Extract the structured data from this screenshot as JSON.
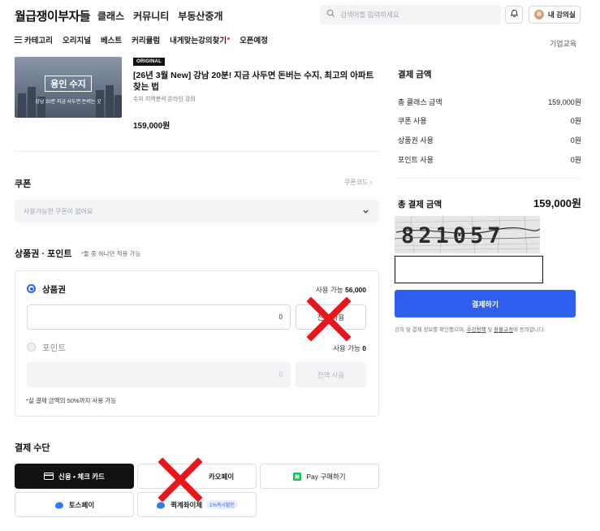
{
  "header": {
    "logo": "월급쟁이부자들",
    "nav": [
      "클래스",
      "커뮤니티",
      "부동산중개"
    ],
    "search_placeholder": "검색어를 입력하세요",
    "user_label": "내 강의실"
  },
  "subnav": {
    "items": [
      "카테고리",
      "오리지널",
      "베스트",
      "커리큘럼",
      "내게맞는강의찾기",
      "오픈예정"
    ],
    "business_link": "기업교육"
  },
  "product": {
    "thumbnail_title": "용인 수지",
    "thumbnail_subtitle": "강남 20분 지금 사두면 돈버는 곳",
    "badge": "ORIGINAL",
    "title": "[26년 3월 New] 강남 20분! 지금 사두면 돈버는 수지, 최고의 아파트 찾는 법",
    "subtitle": "수지 지역분석 온라인 강의",
    "price": "159,000원"
  },
  "coupon": {
    "heading": "쿠폰",
    "code_link": "쿠폰코드 ›",
    "select_placeholder": "사용가능한 쿠폰이 없어요"
  },
  "gift_point": {
    "heading": "상품권 · 포인트",
    "note": "*둘 중 하나만 적용 가능",
    "gift": {
      "label": "상품권",
      "available_prefix": "사용 가능",
      "available_value": "56,000",
      "input_value": "0",
      "all_button": "전액 사용"
    },
    "point": {
      "label": "포인트",
      "available_prefix": "사용 가능",
      "available_value": "0",
      "input_value": "0",
      "all_button": "전액 사용"
    },
    "limit_note": "*실 결제 금액의 50%까지 사용 가능"
  },
  "payment_method": {
    "heading": "결제 수단",
    "options": [
      {
        "label": "신용 • 체크 카드",
        "selected": true
      },
      {
        "label": "카오페이",
        "selected": false
      },
      {
        "label": "Pay 구매하기",
        "selected": false
      },
      {
        "label": "토스페이",
        "selected": false
      },
      {
        "label": "퀵계좌이체",
        "selected": false,
        "tag": "1%즉시할인"
      }
    ]
  },
  "summary": {
    "title": "결제 금액",
    "rows": [
      {
        "label": "총 클래스 금액",
        "value": "159,000원"
      },
      {
        "label": "쿠폰 사용",
        "value": "0원"
      },
      {
        "label": "상품권 사용",
        "value": "0원"
      },
      {
        "label": "포인트 사용",
        "value": "0원"
      }
    ],
    "total_label": "총 결제 금액",
    "total_value": "159,000원",
    "captcha_text": "821057",
    "captcha_input_value": "",
    "pay_button": "결제하기",
    "agree_before": "강의 및 결제 정보를 확인했으며,",
    "agree_link1": "수강정책",
    "agree_mid": "및",
    "agree_link2": "환불규정",
    "agree_after": "에 동의합니다."
  },
  "colors": {
    "accent": "#2f5ef0",
    "selected_method_bg": "#111111",
    "cross_mark": "#e8151b",
    "naver_green": "#03c75a",
    "toss_blue": "#2f7cf6"
  }
}
